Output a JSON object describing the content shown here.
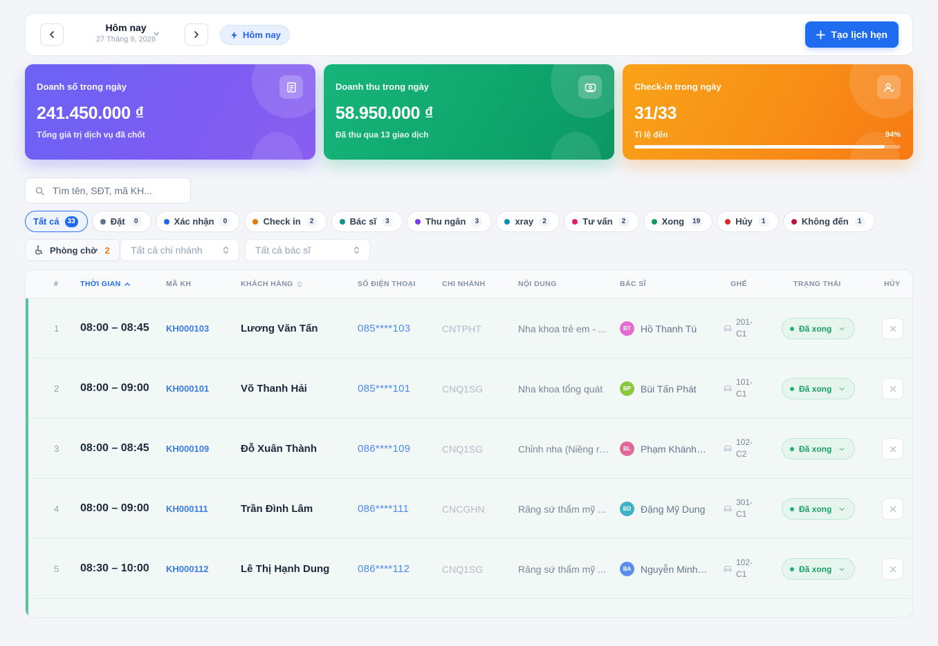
{
  "header": {
    "date_title": "Hôm nay",
    "date_sub": "27 Tháng 9, 2026",
    "today_label": "Hôm nay",
    "create_label": "Tạo lịch hẹn"
  },
  "cards": {
    "sales": {
      "title": "Doanh số trong ngày",
      "value": "241.450.000 ₫",
      "sub": "Tổng giá trị dịch vụ đã chốt",
      "icon": "receipt-icon"
    },
    "revenue": {
      "title": "Doanh thu trong ngày",
      "value": "58.950.000 ₫",
      "sub": "Đã thu qua 13 giao dịch",
      "icon": "cash-icon"
    },
    "checkin": {
      "title": "Check-in trong ngày",
      "value": "31/33",
      "sub": "Tỉ lệ đến",
      "rate_label": "94%",
      "rate": 0.94,
      "icon": "user-check-icon"
    }
  },
  "search": {
    "placeholder": "Tìm tên, SĐT, mã KH..."
  },
  "chips": [
    {
      "label": "Tất cả",
      "count": "33",
      "active": true,
      "color": ""
    },
    {
      "label": "Đặt",
      "count": "0",
      "color": "#64748b"
    },
    {
      "label": "Xác nhận",
      "count": "0",
      "color": "#2563eb"
    },
    {
      "label": "Check in",
      "count": "2",
      "color": "#e07a0e"
    },
    {
      "label": "Bác sĩ",
      "count": "3",
      "color": "#0d9488"
    },
    {
      "label": "Thu ngân",
      "count": "3",
      "color": "#7c3aed"
    },
    {
      "label": "xray",
      "count": "2",
      "color": "#0891b2"
    },
    {
      "label": "Tư vấn",
      "count": "2",
      "color": "#e11d63"
    },
    {
      "label": "Xong",
      "count": "19",
      "color": "#15995f"
    },
    {
      "label": "Hủy",
      "count": "1",
      "color": "#dc2626"
    },
    {
      "label": "Không đến",
      "count": "1",
      "color": "#be123c"
    }
  ],
  "filters": {
    "waiting_label": "Phòng chờ",
    "waiting_count": "2",
    "branch_placeholder": "Tất cả chi nhánh",
    "doctor_placeholder": "Tất cả bác sĩ"
  },
  "table": {
    "headers": {
      "idx": "#",
      "time": "THỜI GIAN",
      "code": "MÃ KH",
      "customer": "KHÁCH HÀNG",
      "phone": "SỐ ĐIỆN THOẠI",
      "branch": "CHI NHÁNH",
      "content": "NỘI DUNG",
      "doctor": "BÁC SĨ",
      "chair": "GHẾ",
      "status": "TRẠNG THÁI",
      "cancel": "HỦY"
    },
    "rows": [
      {
        "idx": "1",
        "time": "08:00 – 08:45",
        "code": "KH000103",
        "name": "Lương Văn Tấn",
        "phone": "085****103",
        "branch": "CNTPHT",
        "content": "Nha khoa trẻ em - ...",
        "doc_initials": "BT",
        "doc_color": "#e36bd2",
        "doctor": "Hồ Thanh Tú",
        "chair_1": "201-",
        "chair_2": "C1",
        "status": "Đã xong"
      },
      {
        "idx": "2",
        "time": "08:00 – 09:00",
        "code": "KH000101",
        "name": "Võ Thanh Hải",
        "phone": "085****101",
        "branch": "CNQ1SG",
        "content": "Nha khoa tổng quát",
        "doc_initials": "BP",
        "doc_color": "#8dc63f",
        "doctor": "Bùi Tấn Phát",
        "chair_1": "101-",
        "chair_2": "C1",
        "status": "Đã xong"
      },
      {
        "idx": "3",
        "time": "08:00 – 08:45",
        "code": "KH000109",
        "name": "Đỗ Xuân Thành",
        "phone": "086****109",
        "branch": "CNQ1SG",
        "content": "Chỉnh nha (Niềng răng)",
        "doc_initials": "BL",
        "doc_color": "#e2679a",
        "doctor": "Phạm Khánh Linh",
        "chair_1": "102-",
        "chair_2": "C2",
        "status": "Đã xong"
      },
      {
        "idx": "4",
        "time": "08:00 – 09:00",
        "code": "KH000111",
        "name": "Trần Đình Lâm",
        "phone": "086****111",
        "branch": "CNCGHN",
        "content": "Răng sứ thẩm mỹ ...",
        "doc_initials": "BD",
        "doc_color": "#3fb1c7",
        "doctor": "Đặng Mỹ Dung",
        "chair_1": "301-",
        "chair_2": "C1",
        "status": "Đã xong"
      },
      {
        "idx": "5",
        "time": "08:30 – 10:00",
        "code": "KH000112",
        "name": "Lê Thị Hạnh Dung",
        "phone": "086****112",
        "branch": "CNQ1SG",
        "content": "Răng sứ thẩm mỹ ...",
        "doc_initials": "BA",
        "doc_color": "#5b8def",
        "doctor": "Nguyễn Minh Anh",
        "chair_1": "102-",
        "chair_2": "C1",
        "status": "Đã xong"
      }
    ]
  }
}
